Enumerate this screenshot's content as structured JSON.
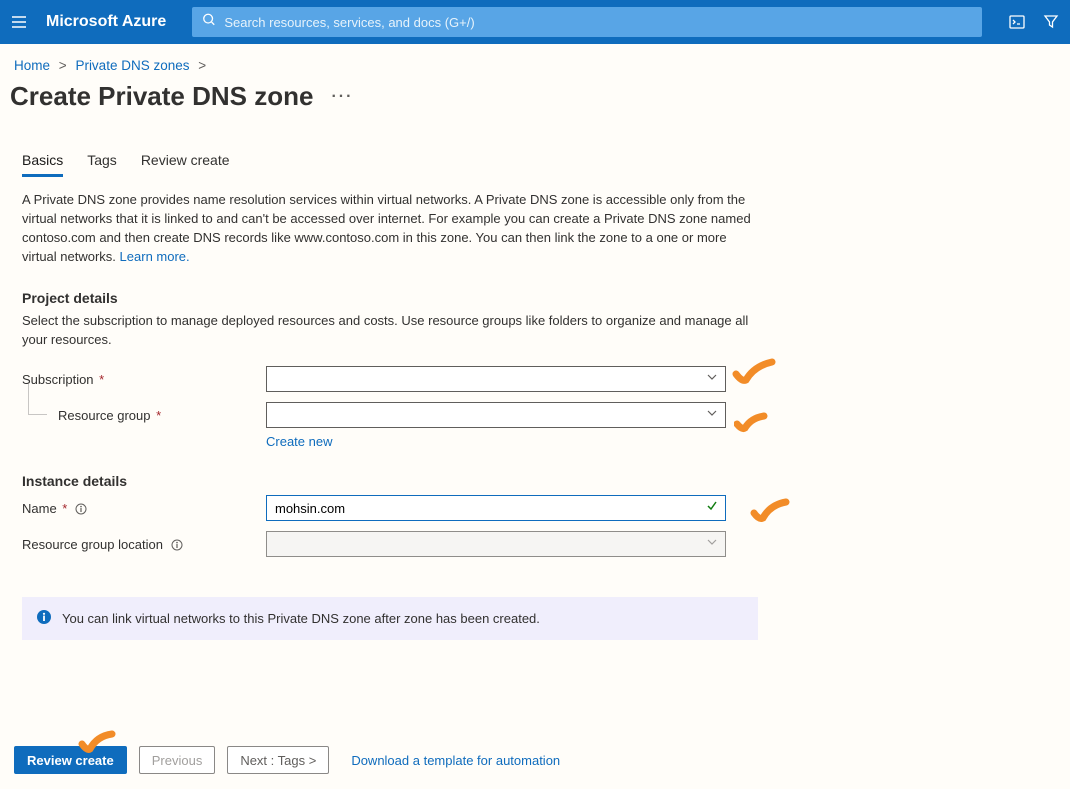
{
  "header": {
    "brand": "Microsoft Azure",
    "search_placeholder": "Search resources, services, and docs (G+/)"
  },
  "breadcrumb": {
    "home": "Home",
    "zones": "Private DNS zones"
  },
  "page_title": "Create Private DNS zone",
  "tabs": {
    "basics": "Basics",
    "tags": "Tags",
    "review": "Review create"
  },
  "description": "A Private DNS zone provides name resolution services within virtual networks. A Private DNS zone is accessible only from the virtual networks that it is linked to and can't be accessed over internet. For example you can create a Private DNS zone named contoso.com and then create DNS records like www.contoso.com in this zone. You can then link the zone to a one or more virtual networks.  ",
  "learn_more": "Learn more.",
  "project": {
    "heading": "Project details",
    "desc": "Select the subscription to manage deployed resources and costs. Use resource groups like folders to organize and manage all your resources.",
    "subscription_label": "Subscription",
    "subscription_value": "",
    "resource_group_label": "Resource group",
    "resource_group_value": "",
    "create_new": "Create new"
  },
  "instance": {
    "heading": "Instance details",
    "name_label": "Name",
    "name_value": "mohsin.com",
    "location_label": "Resource group location",
    "location_value": ""
  },
  "infobox": "You can link virtual networks to this Private DNS zone after zone has been created.",
  "footer": {
    "review": "Review create",
    "previous": "Previous",
    "next": "Next : Tags >",
    "download": "Download a template for automation"
  }
}
